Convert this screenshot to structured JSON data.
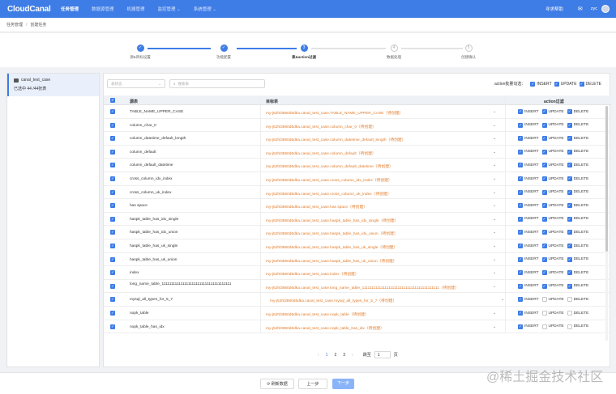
{
  "app": {
    "logo": "CloudCanal",
    "nav": [
      "任务管理",
      "数据源管理",
      "机器管理",
      "监控管理 ⌄",
      "系统管理 ⌄"
    ],
    "help": "寻求帮助",
    "bell": "✉",
    "user": "zyc"
  },
  "breadcrumb": [
    "任务管理",
    "创建任务"
  ],
  "steps": [
    {
      "label": "源&目标设置",
      "state": "done",
      "num": "✓"
    },
    {
      "label": "功能配置",
      "state": "done",
      "num": "✓"
    },
    {
      "label": "表&action过滤",
      "state": "current",
      "num": "3"
    },
    {
      "label": "数据处理",
      "state": "todo",
      "num": "4"
    },
    {
      "label": "创建确认",
      "state": "todo",
      "num": "5"
    }
  ],
  "left": {
    "db_name": "canal_test_case",
    "count": "已选中 44 /44张表"
  },
  "filters": {
    "select_placeholder": "表状态",
    "search_placeholder": "搜索表"
  },
  "batch": {
    "label": "action批量勾选：",
    "insert": "INSERT",
    "update": "UPDATE",
    "delete": "DELETE"
  },
  "table": {
    "headers": {
      "src": "源表",
      "tgt": "目标表",
      "act": "action过滤"
    },
    "rows": [
      {
        "src": "TABLE_NAME_UPPER_CASE",
        "tgt": "my-j52hl3860d6dka.canal_test_case.TABLE_NAME_UPPER_CASE（待创建）",
        "insert": true,
        "update": true,
        "delete": true
      },
      {
        "src": "column_char_0",
        "tgt": "my-j52hl3860d6dka.canal_test_case.column_char_0（待创建）",
        "insert": true,
        "update": true,
        "delete": true
      },
      {
        "src": "column_datetime_default_length",
        "tgt": "my-j52hl3860d6dka.canal_test_case.column_datetime_default_length（待创建）",
        "insert": true,
        "update": true,
        "delete": true
      },
      {
        "src": "column_default",
        "tgt": "my-j52hl3860d6dka.canal_test_case.column_default（待创建）",
        "insert": true,
        "update": true,
        "delete": true
      },
      {
        "src": "column_default_datetime",
        "tgt": "my-j52hl3860d6dka.canal_test_case.column_default_datetime（待创建）",
        "insert": true,
        "update": true,
        "delete": true
      },
      {
        "src": "cross_column_idx_index",
        "tgt": "my-j52hl3860d6dka.canal_test_case.cross_column_idx_index（待创建）",
        "insert": true,
        "update": true,
        "delete": true
      },
      {
        "src": "cross_column_uk_index",
        "tgt": "my-j52hl3860d6dka.canal_test_case.cross_column_uk_index（待创建）",
        "insert": true,
        "update": true,
        "delete": true
      },
      {
        "src": "has space",
        "tgt": "my-j52hl3860d6dka.canal_test_case.has space（待创建）",
        "insert": true,
        "update": true,
        "delete": true
      },
      {
        "src": "haspk_table_has_idx_single",
        "tgt": "my-j52hl3860d6dka.canal_test_case.haspk_table_has_idx_single（待创建）",
        "insert": true,
        "update": true,
        "delete": true
      },
      {
        "src": "haspk_table_has_idx_union",
        "tgt": "my-j52hl3860d6dka.canal_test_case.haspk_table_has_idx_union（待创建）",
        "insert": true,
        "update": true,
        "delete": true
      },
      {
        "src": "haspk_table_has_uk_single",
        "tgt": "my-j52hl3860d6dka.canal_test_case.haspk_table_has_uk_single（待创建）",
        "insert": true,
        "update": true,
        "delete": true
      },
      {
        "src": "haspk_table_has_uk_union",
        "tgt": "my-j52hl3860d6dka.canal_test_case.haspk_table_has_uk_union（待创建）",
        "insert": true,
        "update": true,
        "delete": true
      },
      {
        "src": "index",
        "tgt": "my-j52hl3860d6dka.canal_test_case.index（待创建）",
        "insert": true,
        "update": true,
        "delete": true
      },
      {
        "src": "long_name_table_1111111111111111111111111111111111111",
        "tgt": "my-j52hl3860d6dka.canal_test_case.long_name_table_11111111111111111111111111111111111111111（待创建）",
        "insert": true,
        "update": true,
        "delete": true
      },
      {
        "src": "mysql_all_types_for_5_7",
        "tgt": "my-j52hl3860d6dka.canal_test_case.mysql_all_types_for_5_7（待创建）",
        "insert": true,
        "update": false,
        "delete": false
      },
      {
        "src": "nopk_table",
        "tgt": "my-j52hl3860d6dka.canal_test_case.nopk_table（待创建）",
        "insert": true,
        "update": false,
        "delete": false
      },
      {
        "src": "nopk_table_has_idx",
        "tgt": "my-j52hl3860d6dka.canal_test_case.nopk_table_has_idx（待创建）",
        "insert": true,
        "update": false,
        "delete": false
      }
    ]
  },
  "pagination": {
    "prev": "‹",
    "pages": [
      "1",
      "2",
      "3"
    ],
    "current": "1",
    "next": "›",
    "goto": "跳至",
    "goto_value": "1",
    "page_suffix": "页"
  },
  "footer": {
    "refresh": "⟳ 刷新数据",
    "prev": "上一步",
    "next": "下一步"
  },
  "watermark": "@稀土掘金技术社区",
  "colors": {
    "accent": "#3e7ce6",
    "target_text": "#e07b2a"
  }
}
